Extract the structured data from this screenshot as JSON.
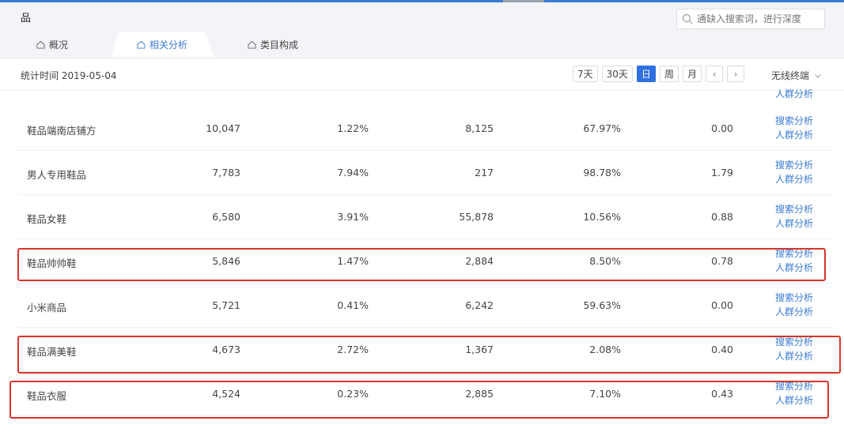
{
  "header": {
    "brand": "品",
    "search_placeholder": "通缺入搜索词，进行深度"
  },
  "tabs": [
    {
      "label": "概况",
      "icon": "house-icon",
      "active": false
    },
    {
      "label": "相关分析",
      "icon": "house-icon",
      "active": true
    },
    {
      "label": "类目构成",
      "icon": "house-icon",
      "active": false
    }
  ],
  "toolbar": {
    "stat_time": "统计时间 2019-05-04",
    "periods": [
      "7天",
      "30天",
      "日",
      "周",
      "月"
    ],
    "active_period": "日",
    "prev": "‹",
    "next": "›",
    "filter_label": "无线终端"
  },
  "partial_link": "人群分析",
  "rows": [
    {
      "name": "鞋品端南店铺方",
      "a": "10,047",
      "b": "1.22%",
      "c": "8,125",
      "d": "67.97%",
      "e": "0.00",
      "link1": "搜索分析",
      "link2": "人群分析"
    },
    {
      "name": "男人专用鞋品",
      "a": "7,783",
      "b": "7.94%",
      "c": "217",
      "d": "98.78%",
      "e": "1.79",
      "link1": "搜索分析",
      "link2": "人群分析"
    },
    {
      "name": "鞋品女鞋",
      "a": "6,580",
      "b": "3.91%",
      "c": "55,878",
      "d": "10.56%",
      "e": "0.88",
      "link1": "搜索分析",
      "link2": "人群分析"
    },
    {
      "name": "鞋品帅帅鞋",
      "a": "5,846",
      "b": "1.47%",
      "c": "2,884",
      "d": "8.50%",
      "e": "0.78",
      "link1": "搜索分析",
      "link2": "人群分析"
    },
    {
      "name": "小米商品",
      "a": "5,721",
      "b": "0.41%",
      "c": "6,242",
      "d": "59.63%",
      "e": "0.00",
      "link1": "搜索分析",
      "link2": "人群分析"
    },
    {
      "name": "鞋品满美鞋",
      "a": "4,673",
      "b": "2.72%",
      "c": "1,367",
      "d": "2.08%",
      "e": "0.40",
      "link1": "搜索分析",
      "link2": "人群分析"
    },
    {
      "name": "鞋品衣服",
      "a": "4,524",
      "b": "0.23%",
      "c": "2,885",
      "d": "7.10%",
      "e": "0.43",
      "link1": "搜索分析",
      "link2": "人群分析"
    }
  ],
  "highlight_color": "#d8342c",
  "accent_color": "#3a7bd5"
}
